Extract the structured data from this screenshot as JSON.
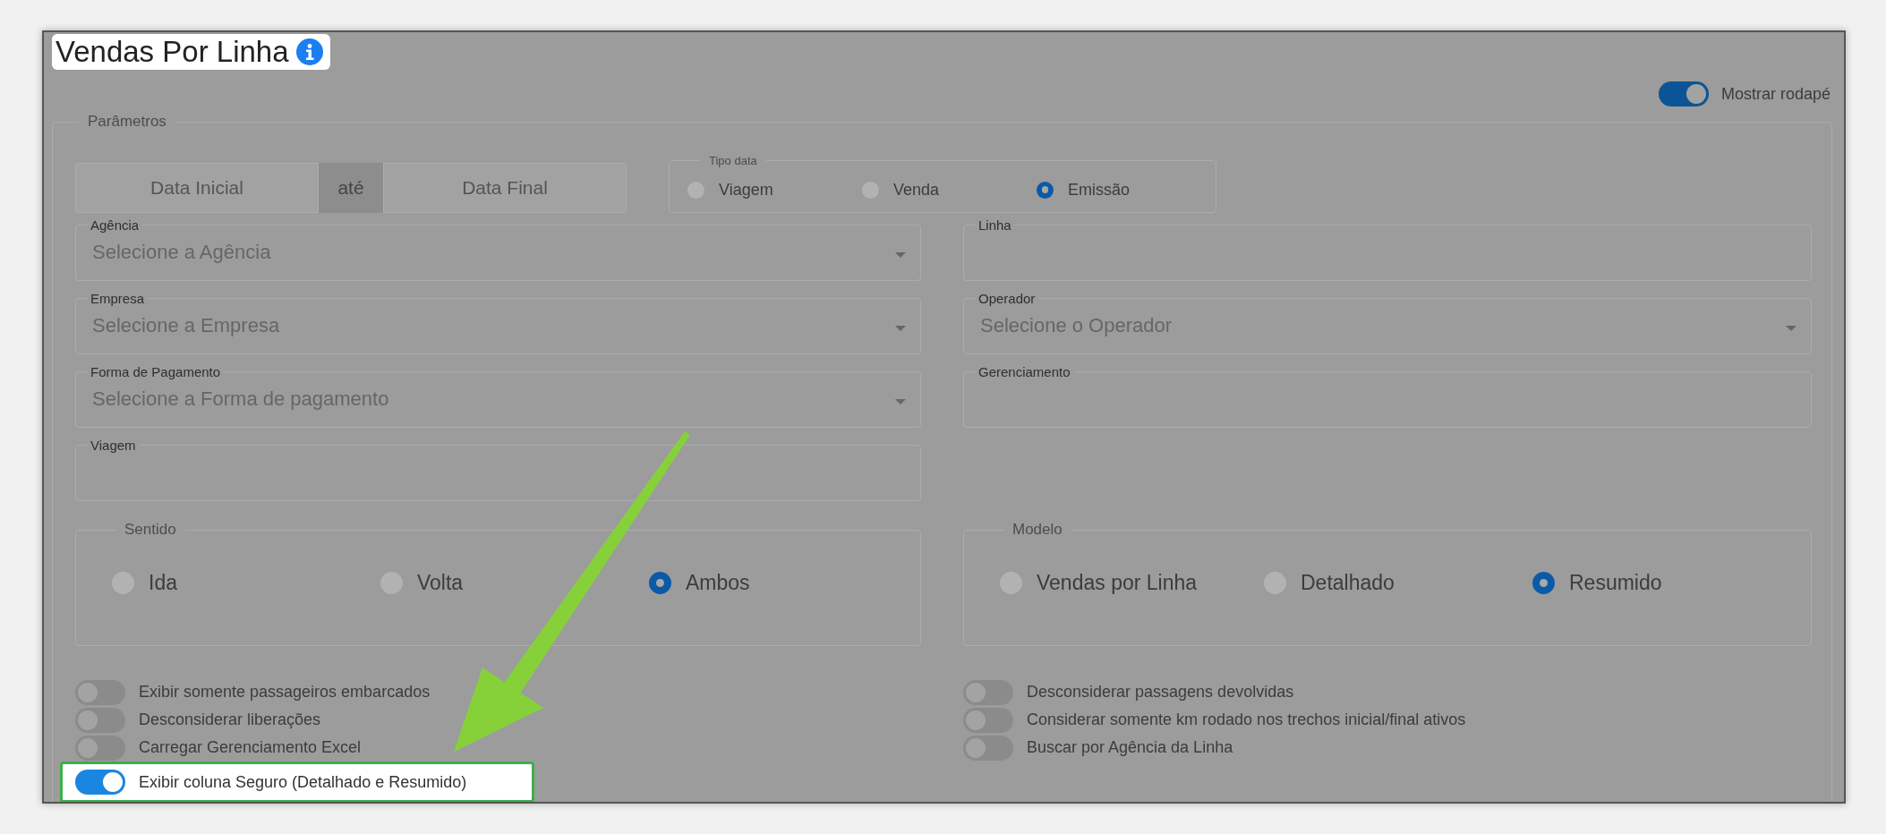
{
  "title": "Vendas Por Linha",
  "footer_toggle": {
    "label": "Mostrar rodapé",
    "on": true
  },
  "parameters": {
    "legend": "Parâmetros",
    "date_range": {
      "start_placeholder": "Data Inicial",
      "separator": "até",
      "end_placeholder": "Data Final"
    },
    "date_type": {
      "legend": "Tipo data",
      "options": [
        {
          "label": "Viagem",
          "selected": false
        },
        {
          "label": "Venda",
          "selected": false
        },
        {
          "label": "Emissão",
          "selected": true
        }
      ]
    },
    "fields": [
      {
        "kind": "select",
        "label": "Agência",
        "placeholder": "Selecione a Agência"
      },
      {
        "kind": "text",
        "label": "Linha"
      },
      {
        "kind": "select",
        "label": "Empresa",
        "placeholder": "Selecione a Empresa"
      },
      {
        "kind": "select",
        "label": "Operador",
        "placeholder": "Selecione o Operador"
      },
      {
        "kind": "select",
        "label": "Forma de Pagamento",
        "placeholder": "Selecione a Forma de pagamento"
      },
      {
        "kind": "text",
        "label": "Gerenciamento"
      },
      {
        "kind": "text",
        "label": "Viagem"
      }
    ],
    "direction": {
      "legend": "Sentido",
      "options": [
        {
          "label": "Ida",
          "selected": false
        },
        {
          "label": "Volta",
          "selected": false
        },
        {
          "label": "Ambos",
          "selected": true
        }
      ]
    },
    "model": {
      "legend": "Modelo",
      "options": [
        {
          "label": "Vendas por Linha",
          "selected": false
        },
        {
          "label": "Detalhado",
          "selected": false
        },
        {
          "label": "Resumido",
          "selected": true
        }
      ]
    },
    "toggles_left": [
      {
        "label": "Exibir somente passageiros embarcados",
        "on": false,
        "highlighted": false
      },
      {
        "label": "Desconsiderar liberações",
        "on": false,
        "highlighted": false
      },
      {
        "label": "Carregar Gerenciamento Excel",
        "on": false,
        "highlighted": false
      },
      {
        "label": "Exibir coluna Seguro (Detalhado e Resumido)",
        "on": true,
        "highlighted": true
      }
    ],
    "toggles_right": [
      {
        "label": "Desconsiderar passagens devolvidas",
        "on": false,
        "highlighted": false
      },
      {
        "label": "Considerar somente km rodado nos trechos inicial/final ativos",
        "on": false,
        "highlighted": false
      },
      {
        "label": "Buscar por Agência da Linha",
        "on": false,
        "highlighted": false
      }
    ]
  }
}
